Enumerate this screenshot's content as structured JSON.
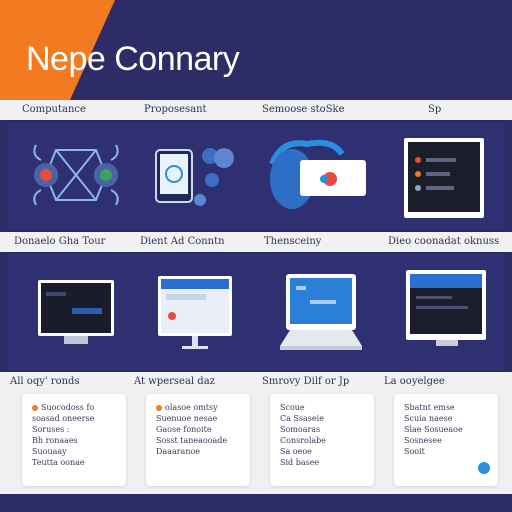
{
  "header": {
    "title": "Nepe Connary"
  },
  "row1_labels": [
    "Computance",
    "Proposesant",
    "Semoose stoSke",
    "Sp"
  ],
  "row2_labels": [
    "Donaelo Gha Tour",
    "Dient Ad Conntn",
    "Thensceiny",
    "Dieo coonadat oknuss"
  ],
  "row3_labels": [
    "All oqy' ronds",
    "At wperseal daz",
    "Smrovy Dilf or Jp",
    "La ooyelgee"
  ],
  "cards": [
    [
      "Suocodoss  fo",
      "soasad oneerse",
      "Soruses :",
      "  Bh ronaaes",
      "",
      "Suouaay",
      "Teutta oonae"
    ],
    [
      "olasoe omtsy",
      "Suenuoe nesae",
      "",
      "Gaose fonoite",
      "  Sosst taneaooade",
      "  Daaaranoe"
    ],
    [
      "Scoue",
      "Ca Ssaseie",
      "Somoaras",
      "Consrolabe",
      "Sa  oeoe",
      "Sid basee"
    ],
    [
      "Sbatnt emse",
      "Scuia naese",
      "Slae Sosueaoe",
      "Sosnesee",
      "  Sooit"
    ]
  ],
  "colors": {
    "navy": "#2d2c67",
    "panel": "#2f3071",
    "orange": "#f27a20",
    "band": "#f1f1f4",
    "accent_blue": "#2a8fe0"
  }
}
